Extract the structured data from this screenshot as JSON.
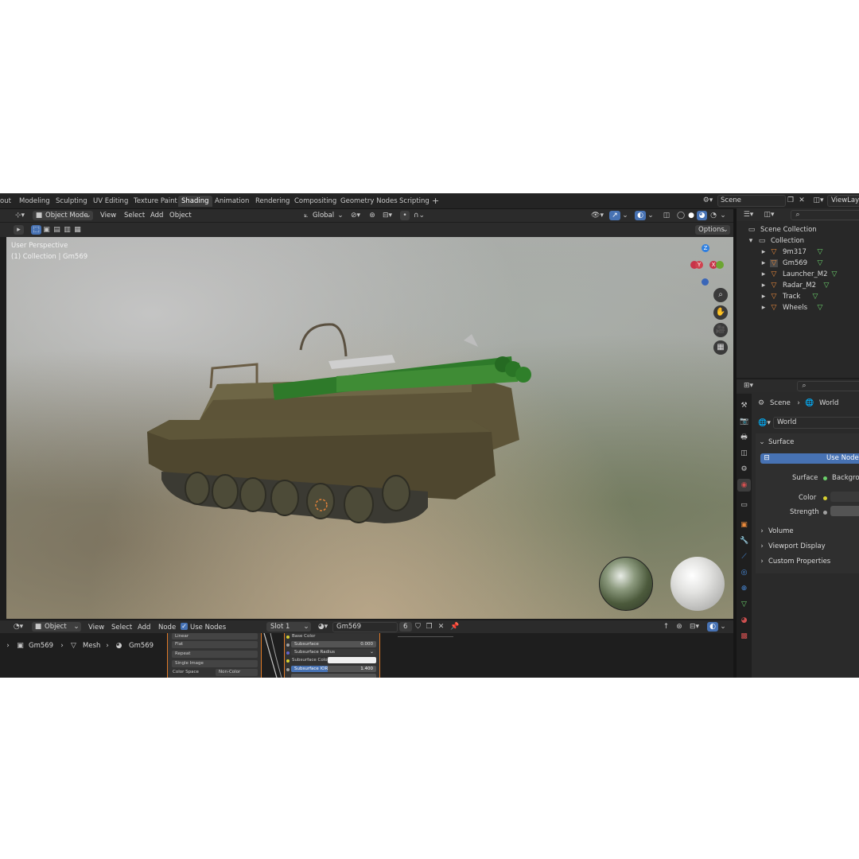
{
  "workspace_tabs": [
    "out",
    "Modeling",
    "Sculpting",
    "UV Editing",
    "Texture Paint",
    "Shading",
    "Animation",
    "Rendering",
    "Compositing",
    "Geometry Nodes",
    "Scripting"
  ],
  "active_tab": "Shading",
  "add_tab": "+",
  "scene_field": "Scene",
  "view_layer": "ViewLaye",
  "viewport_header": {
    "mode": "Object Mode",
    "menus": [
      "View",
      "Select",
      "Add",
      "Object"
    ],
    "transform": "Global",
    "options": "Options"
  },
  "viewport_overlay": {
    "line1": "User Perspective",
    "line2": "(1) Collection | Gm569"
  },
  "gizmo": {
    "z": "Z",
    "x": "X",
    "y": "Y"
  },
  "outliner": {
    "scene_collection": "Scene Collection",
    "collection": "Collection",
    "objects": [
      "9m317",
      "Gm569",
      "Launcher_M2",
      "Radar_M2",
      "Track",
      "Wheels"
    ]
  },
  "properties": {
    "breadcrumb_scene": "Scene",
    "breadcrumb_world": "World",
    "world_name": "World",
    "surface_panel": "Surface",
    "use_nodes": "Use Nodes",
    "surface_label": "Surface",
    "surface_value": "Backgrou",
    "color_label": "Color",
    "strength_label": "Strength",
    "panels": [
      "Volume",
      "Viewport Display",
      "Custom Properties"
    ]
  },
  "node_header": {
    "mode": "Object",
    "menus": [
      "View",
      "Select",
      "Add",
      "Node"
    ],
    "use_nodes": "Use Nodes",
    "slot": "Slot 1",
    "material": "Gm569",
    "users": "6"
  },
  "node_breadcrumb": [
    "Gm569",
    "Mesh",
    "Gm569"
  ],
  "image_node": [
    "Linear",
    "Flat",
    "Repeat",
    "Single Image"
  ],
  "image_node_colorspace_label": "Color Space",
  "image_node_colorspace_value": "Non-Color",
  "bsdf_node": {
    "base_color": "Base Color",
    "subsurface": "Subsurface",
    "subsurface_value": "0.000",
    "subsurface_radius": "Subsurface Radius",
    "subsurface_color": "Subsurface Color",
    "subsurface_ior": "Subsurface IOR",
    "subsurface_ior_value": "1.400"
  },
  "colors": {
    "accent": "#4772b3",
    "active_tab": "#3d3d3d",
    "mesh_icon": "#e8893b",
    "vertex_group": "#6bd06b"
  }
}
